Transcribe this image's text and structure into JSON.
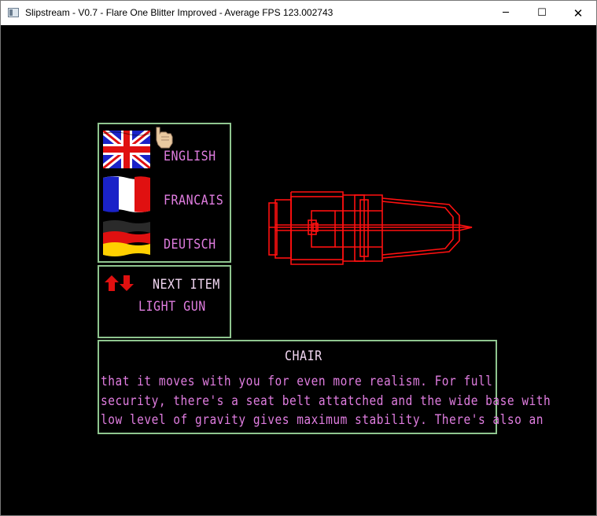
{
  "window": {
    "title": "Slipstream - V0.7 - Flare One Blitter Improved - Average FPS 123.002743",
    "controls": {
      "minimize": "─",
      "maximize": "☐",
      "close": "✕"
    }
  },
  "languages": [
    {
      "label": "ENGLISH",
      "flag": "uk-flag-icon"
    },
    {
      "label": "FRANCAIS",
      "flag": "france-flag-icon"
    },
    {
      "label": "DEUTSCH",
      "flag": "germany-flag-icon"
    }
  ],
  "item_selector": {
    "next_label": "NEXT ITEM",
    "current_item": "LIGHT GUN"
  },
  "description": {
    "title": "CHAIR",
    "lines": [
      "that  it  moves  with  you for  even  more  realism.  For full",
      "security, there's a seat belt attatched and the wide base with",
      "low level of gravity gives maximum stability.  There's also an"
    ]
  },
  "colors": {
    "panel_border": "#8fc58f",
    "text_magenta": "#e07de0",
    "text_highlight": "#f2d7f2",
    "wireframe": "#ff1010",
    "background": "#000000"
  }
}
